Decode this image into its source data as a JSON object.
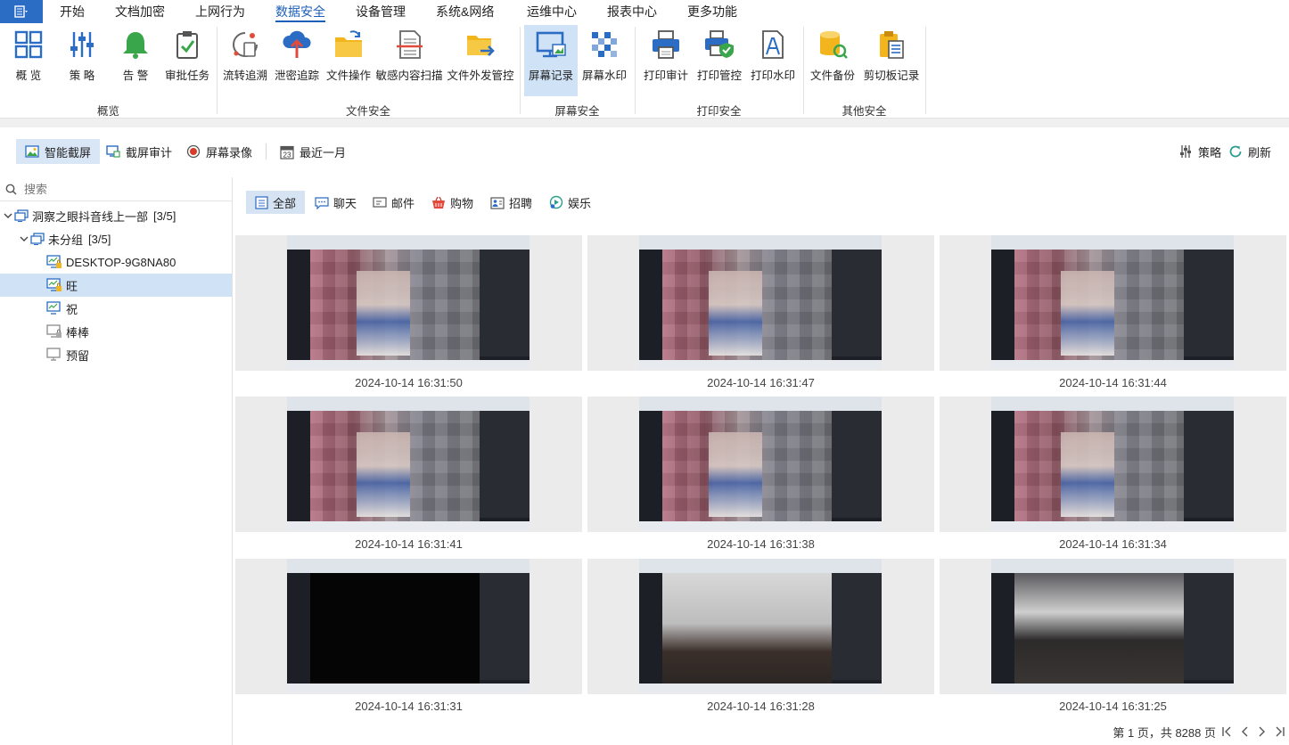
{
  "menubar": {
    "tabs": [
      "开始",
      "文档加密",
      "上网行为",
      "数据安全",
      "设备管理",
      "系统&网络",
      "运维中心",
      "报表中心",
      "更多功能"
    ],
    "active_index": 3,
    "active_color": "#1c5fb8"
  },
  "ribbon": {
    "buttons": [
      {
        "label": "概 览",
        "icon": "overview-grid-icon"
      },
      {
        "label": "策 略",
        "icon": "policy-sliders-icon"
      },
      {
        "label": "告 警",
        "icon": "alarm-bell-icon"
      },
      {
        "label": "审批任务",
        "icon": "approval-clipboard-icon"
      },
      {
        "label": "流转追溯",
        "icon": "flow-trace-icon"
      },
      {
        "label": "泄密追踪",
        "icon": "leak-cloud-icon"
      },
      {
        "label": "文件操作",
        "icon": "file-folder-icon"
      },
      {
        "label": "敏感内容扫描",
        "icon": "sensitive-scan-icon"
      },
      {
        "label": "文件外发管控",
        "icon": "file-send-icon"
      },
      {
        "label": "屏幕记录",
        "icon": "screen-record-icon"
      },
      {
        "label": "屏幕水印",
        "icon": "screen-watermark-icon"
      },
      {
        "label": "打印审计",
        "icon": "printer-icon"
      },
      {
        "label": "打印管控",
        "icon": "print-control-icon"
      },
      {
        "label": "打印水印",
        "icon": "print-watermark-icon"
      },
      {
        "label": "文件备份",
        "icon": "file-backup-icon"
      },
      {
        "label": "剪切板记录",
        "icon": "clipboard-record-icon"
      }
    ],
    "active_index": 9,
    "groups": [
      "概览",
      "文件安全",
      "屏幕安全",
      "打印安全",
      "其他安全"
    ]
  },
  "toolbar": {
    "smart_capture": "智能截屏",
    "capture_audit": "截屏审计",
    "screen_video": "屏幕录像",
    "date_range": "最近一月",
    "calendar_day": "23",
    "policy": "策略",
    "refresh": "刷新"
  },
  "sidebar": {
    "search_placeholder": "搜索",
    "root": {
      "label": "洞察之眼抖音线上一部",
      "count": "[3/5]"
    },
    "group": {
      "label": "未分组",
      "count": "[3/5]"
    },
    "devices": [
      {
        "label": "DESKTOP-9G8NA80",
        "status": "online-locked"
      },
      {
        "label": "旺",
        "status": "online-locked"
      },
      {
        "label": "祝",
        "status": "online"
      },
      {
        "label": "棒棒",
        "status": "offline-locked"
      },
      {
        "label": "预留",
        "status": "offline"
      }
    ],
    "selected_index": 1
  },
  "categories": [
    "全部",
    "聊天",
    "邮件",
    "购物",
    "招聘",
    "娱乐"
  ],
  "active_category": 0,
  "screenshots": [
    {
      "time": "2024-10-14 16:31:50"
    },
    {
      "time": "2024-10-14 16:31:47"
    },
    {
      "time": "2024-10-14 16:31:44"
    },
    {
      "time": "2024-10-14 16:31:41"
    },
    {
      "time": "2024-10-14 16:31:38"
    },
    {
      "time": "2024-10-14 16:31:34"
    },
    {
      "time": "2024-10-14 16:31:31"
    },
    {
      "time": "2024-10-14 16:31:28"
    },
    {
      "time": "2024-10-14 16:31:25"
    }
  ],
  "pager": {
    "text": "第 1 页，共 8288 页"
  },
  "colors": {
    "accent": "#2b6cc4",
    "selected": "#cfe2f6"
  }
}
